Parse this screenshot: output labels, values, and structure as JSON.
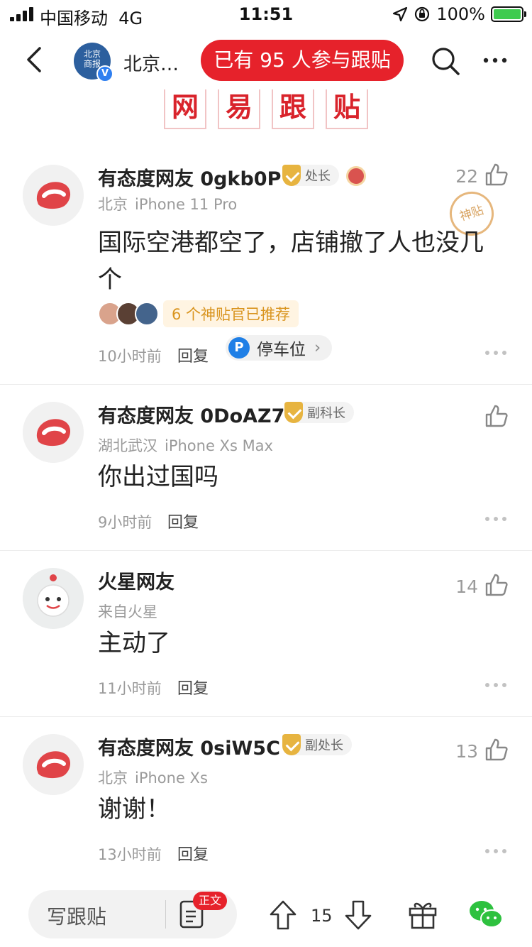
{
  "status_bar": {
    "carrier": "中国移动",
    "network": "4G",
    "time": "11:51",
    "battery": "100%"
  },
  "nav": {
    "source_name": "北京…",
    "source_avatar_text": "北京\n商报",
    "participate": "已有 95 人参与跟贴"
  },
  "banner": {
    "chars": [
      "网",
      "易",
      "跟",
      "贴"
    ]
  },
  "comments": [
    {
      "username": "有态度网友 0gkb0P",
      "rank": "处长",
      "location": "北京",
      "device": "iPhone 11 Pro",
      "likes": "22",
      "content": "国际空港都空了，店铺撤了人也没几个",
      "stamp": "神贴",
      "recommend": "6 个神贴官已推荐",
      "time": "10小时前",
      "reply": "回复",
      "chip": "停车位",
      "chip_icon": "P"
    },
    {
      "username": "有态度网友 0DoAZ7",
      "rank": "副科长",
      "location": "湖北武汉",
      "device": "iPhone Xs Max",
      "likes": "",
      "content": "你出过国吗",
      "time": "9小时前",
      "reply": "回复"
    },
    {
      "username": "火星网友",
      "location": "来自火星",
      "likes": "14",
      "content": "主动了",
      "time": "11小时前",
      "reply": "回复"
    },
    {
      "username": "有态度网友 0siW5C",
      "rank": "副处长",
      "location": "北京",
      "device": "iPhone Xs",
      "likes": "13",
      "content": "谢谢！",
      "time": "13小时前",
      "reply": "回复"
    }
  ],
  "bottom": {
    "write": "写跟贴",
    "article_badge": "正文",
    "vote_count": "15"
  },
  "colors": {
    "brand_red": "#e6222b",
    "meta_gray": "#9a9a9a",
    "gold": "#e7b440"
  }
}
